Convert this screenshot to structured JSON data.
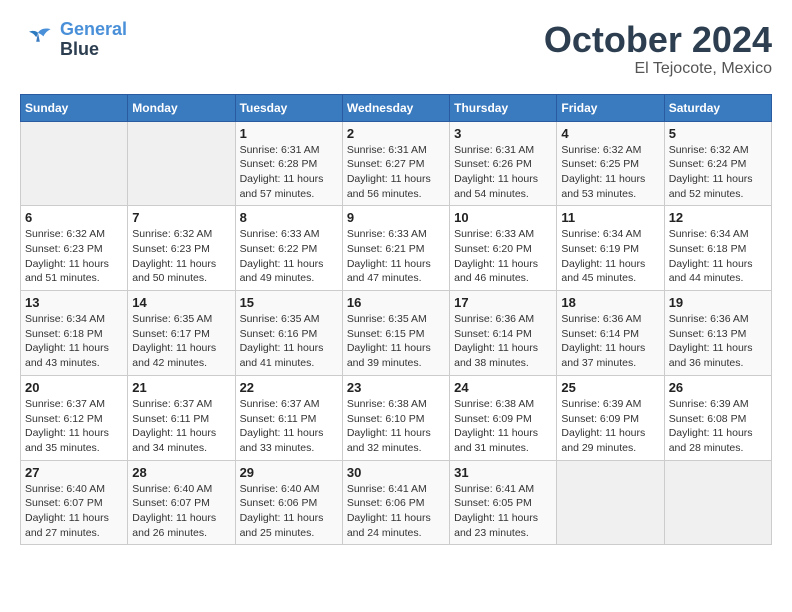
{
  "header": {
    "logo_line1": "General",
    "logo_line2": "Blue",
    "month": "October 2024",
    "location": "El Tejocote, Mexico"
  },
  "weekdays": [
    "Sunday",
    "Monday",
    "Tuesday",
    "Wednesday",
    "Thursday",
    "Friday",
    "Saturday"
  ],
  "weeks": [
    [
      {
        "day": "",
        "empty": true
      },
      {
        "day": "",
        "empty": true
      },
      {
        "day": "1",
        "sunrise": "6:31 AM",
        "sunset": "6:28 PM",
        "daylight": "11 hours and 57 minutes."
      },
      {
        "day": "2",
        "sunrise": "6:31 AM",
        "sunset": "6:27 PM",
        "daylight": "11 hours and 56 minutes."
      },
      {
        "day": "3",
        "sunrise": "6:31 AM",
        "sunset": "6:26 PM",
        "daylight": "11 hours and 54 minutes."
      },
      {
        "day": "4",
        "sunrise": "6:32 AM",
        "sunset": "6:25 PM",
        "daylight": "11 hours and 53 minutes."
      },
      {
        "day": "5",
        "sunrise": "6:32 AM",
        "sunset": "6:24 PM",
        "daylight": "11 hours and 52 minutes."
      }
    ],
    [
      {
        "day": "6",
        "sunrise": "6:32 AM",
        "sunset": "6:23 PM",
        "daylight": "11 hours and 51 minutes."
      },
      {
        "day": "7",
        "sunrise": "6:32 AM",
        "sunset": "6:23 PM",
        "daylight": "11 hours and 50 minutes."
      },
      {
        "day": "8",
        "sunrise": "6:33 AM",
        "sunset": "6:22 PM",
        "daylight": "11 hours and 49 minutes."
      },
      {
        "day": "9",
        "sunrise": "6:33 AM",
        "sunset": "6:21 PM",
        "daylight": "11 hours and 47 minutes."
      },
      {
        "day": "10",
        "sunrise": "6:33 AM",
        "sunset": "6:20 PM",
        "daylight": "11 hours and 46 minutes."
      },
      {
        "day": "11",
        "sunrise": "6:34 AM",
        "sunset": "6:19 PM",
        "daylight": "11 hours and 45 minutes."
      },
      {
        "day": "12",
        "sunrise": "6:34 AM",
        "sunset": "6:18 PM",
        "daylight": "11 hours and 44 minutes."
      }
    ],
    [
      {
        "day": "13",
        "sunrise": "6:34 AM",
        "sunset": "6:18 PM",
        "daylight": "11 hours and 43 minutes."
      },
      {
        "day": "14",
        "sunrise": "6:35 AM",
        "sunset": "6:17 PM",
        "daylight": "11 hours and 42 minutes."
      },
      {
        "day": "15",
        "sunrise": "6:35 AM",
        "sunset": "6:16 PM",
        "daylight": "11 hours and 41 minutes."
      },
      {
        "day": "16",
        "sunrise": "6:35 AM",
        "sunset": "6:15 PM",
        "daylight": "11 hours and 39 minutes."
      },
      {
        "day": "17",
        "sunrise": "6:36 AM",
        "sunset": "6:14 PM",
        "daylight": "11 hours and 38 minutes."
      },
      {
        "day": "18",
        "sunrise": "6:36 AM",
        "sunset": "6:14 PM",
        "daylight": "11 hours and 37 minutes."
      },
      {
        "day": "19",
        "sunrise": "6:36 AM",
        "sunset": "6:13 PM",
        "daylight": "11 hours and 36 minutes."
      }
    ],
    [
      {
        "day": "20",
        "sunrise": "6:37 AM",
        "sunset": "6:12 PM",
        "daylight": "11 hours and 35 minutes."
      },
      {
        "day": "21",
        "sunrise": "6:37 AM",
        "sunset": "6:11 PM",
        "daylight": "11 hours and 34 minutes."
      },
      {
        "day": "22",
        "sunrise": "6:37 AM",
        "sunset": "6:11 PM",
        "daylight": "11 hours and 33 minutes."
      },
      {
        "day": "23",
        "sunrise": "6:38 AM",
        "sunset": "6:10 PM",
        "daylight": "11 hours and 32 minutes."
      },
      {
        "day": "24",
        "sunrise": "6:38 AM",
        "sunset": "6:09 PM",
        "daylight": "11 hours and 31 minutes."
      },
      {
        "day": "25",
        "sunrise": "6:39 AM",
        "sunset": "6:09 PM",
        "daylight": "11 hours and 29 minutes."
      },
      {
        "day": "26",
        "sunrise": "6:39 AM",
        "sunset": "6:08 PM",
        "daylight": "11 hours and 28 minutes."
      }
    ],
    [
      {
        "day": "27",
        "sunrise": "6:40 AM",
        "sunset": "6:07 PM",
        "daylight": "11 hours and 27 minutes."
      },
      {
        "day": "28",
        "sunrise": "6:40 AM",
        "sunset": "6:07 PM",
        "daylight": "11 hours and 26 minutes."
      },
      {
        "day": "29",
        "sunrise": "6:40 AM",
        "sunset": "6:06 PM",
        "daylight": "11 hours and 25 minutes."
      },
      {
        "day": "30",
        "sunrise": "6:41 AM",
        "sunset": "6:06 PM",
        "daylight": "11 hours and 24 minutes."
      },
      {
        "day": "31",
        "sunrise": "6:41 AM",
        "sunset": "6:05 PM",
        "daylight": "11 hours and 23 minutes."
      },
      {
        "day": "",
        "empty": true
      },
      {
        "day": "",
        "empty": true
      }
    ]
  ]
}
